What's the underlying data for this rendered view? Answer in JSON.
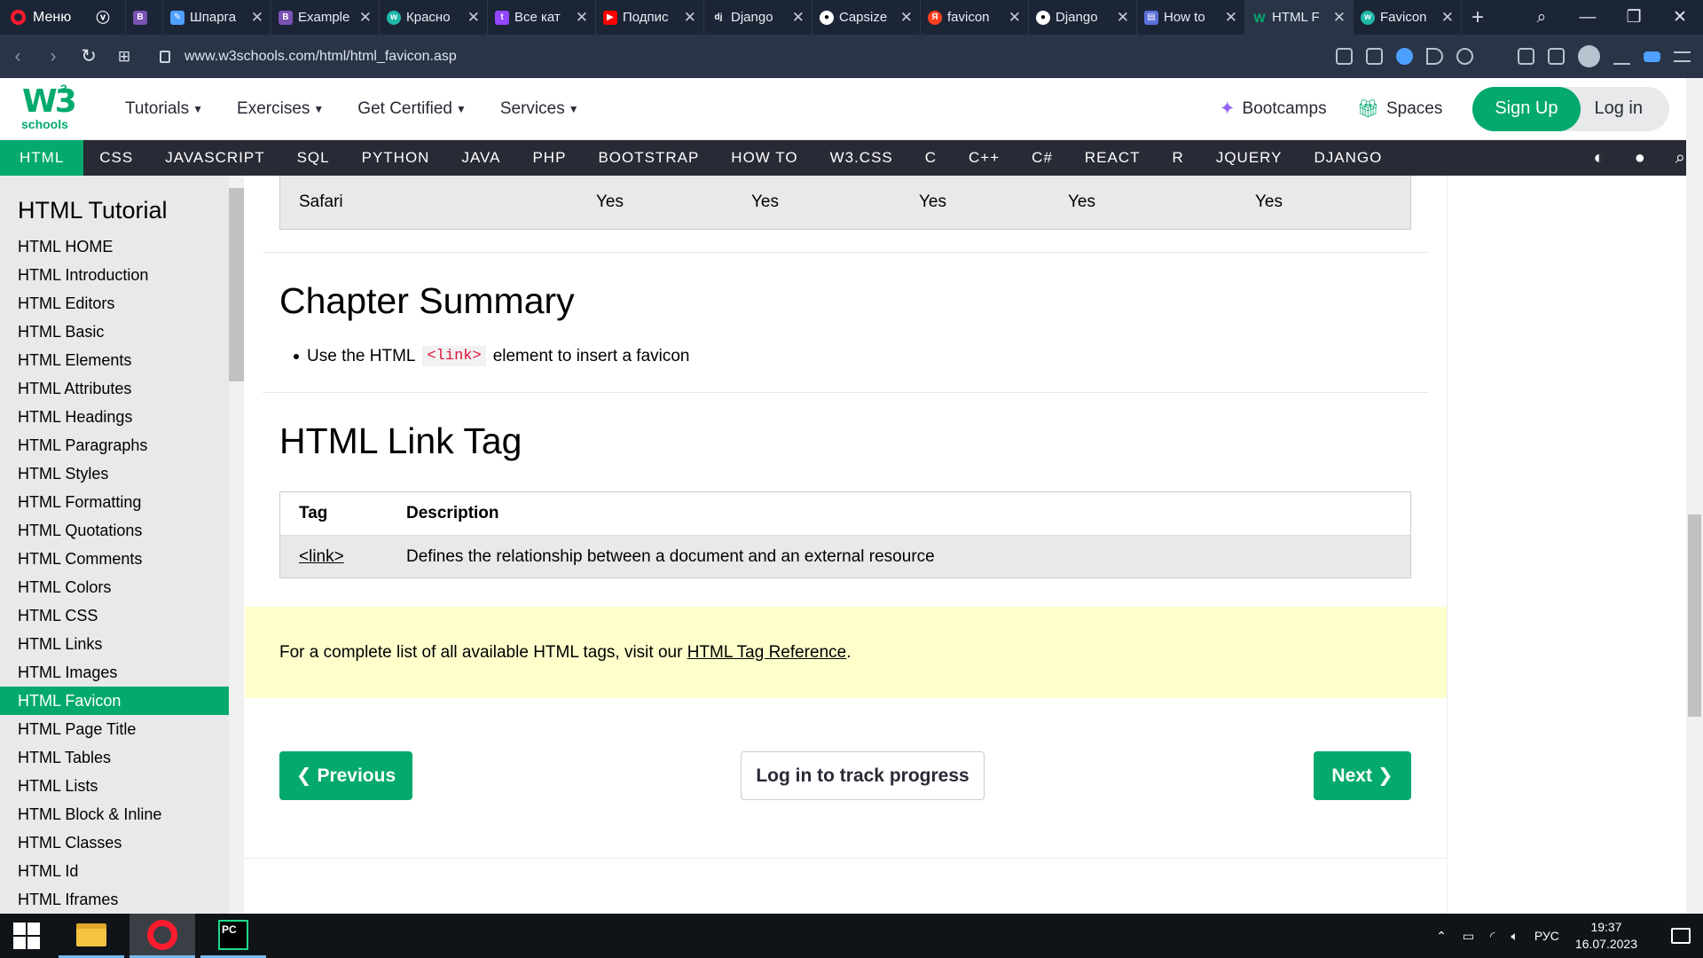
{
  "browser": {
    "menu_label": "Меню",
    "tabs": [
      {
        "label": "",
        "icon": "vk-icon",
        "color": "#0077ff"
      },
      {
        "label": "",
        "icon": "bootstrap-icon",
        "color": "#7952b3"
      },
      {
        "label": "Шпарга",
        "icon": "pen-icon",
        "color": "#4da0ff"
      },
      {
        "label": "Example",
        "icon": "bootstrap-icon",
        "color": "#7952b3"
      },
      {
        "label": "Красно",
        "icon": "w3-icon",
        "color": "#04aa6d"
      },
      {
        "label": "Все кат",
        "icon": "twitch-icon",
        "color": "#9146ff"
      },
      {
        "label": "Подпис",
        "icon": "youtube-icon",
        "color": "#ff0000"
      },
      {
        "label": "Django",
        "icon": "django-icon",
        "color": "#0c4b33"
      },
      {
        "label": "Capsize",
        "icon": "github-icon",
        "color": "#24292e"
      },
      {
        "label": "favicon",
        "icon": "yandex-icon",
        "color": "#fc3f1d"
      },
      {
        "label": "Django",
        "icon": "github-icon",
        "color": "#24292e"
      },
      {
        "label": "How to",
        "icon": "page-icon",
        "color": "#5b6fd9"
      },
      {
        "label": "HTML F",
        "icon": "w3-icon",
        "color": "#04aa6d",
        "active": true
      },
      {
        "label": "Favicon",
        "icon": "w3-icon",
        "color": "#04aa6d"
      }
    ],
    "url": "www.w3schools.com/html/html_favicon.asp"
  },
  "site": {
    "logo_text": "W3",
    "logo_sup": "3",
    "logo_sub": "schools",
    "menu": [
      "Tutorials",
      "Exercises",
      "Get Certified",
      "Services"
    ],
    "bootcamps": "Bootcamps",
    "spaces": "Spaces",
    "signup": "Sign Up",
    "login": "Log in",
    "brand_color": "#04aa6d"
  },
  "subjects": [
    "HTML",
    "CSS",
    "JAVASCRIPT",
    "SQL",
    "PYTHON",
    "JAVA",
    "PHP",
    "BOOTSTRAP",
    "HOW TO",
    "W3.CSS",
    "C",
    "C++",
    "C#",
    "REACT",
    "R",
    "JQUERY",
    "DJANGO"
  ],
  "sidebar": {
    "title": "HTML Tutorial",
    "items": [
      "HTML HOME",
      "HTML Introduction",
      "HTML Editors",
      "HTML Basic",
      "HTML Elements",
      "HTML Attributes",
      "HTML Headings",
      "HTML Paragraphs",
      "HTML Styles",
      "HTML Formatting",
      "HTML Quotations",
      "HTML Comments",
      "HTML Colors",
      "HTML CSS",
      "HTML Links",
      "HTML Images",
      "HTML Favicon",
      "HTML Page Title",
      "HTML Tables",
      "HTML Lists",
      "HTML Block & Inline",
      "HTML Classes",
      "HTML Id",
      "HTML Iframes"
    ],
    "active": "HTML Favicon"
  },
  "content": {
    "support_row": {
      "browser": "Safari",
      "values": [
        "Yes",
        "Yes",
        "Yes",
        "Yes",
        "Yes"
      ]
    },
    "summary_heading": "Chapter Summary",
    "summary_pre": "Use the HTML",
    "summary_code": "<link>",
    "summary_post": "element to insert a favicon",
    "link_heading": "HTML Link Tag",
    "table": {
      "headers": [
        "Tag",
        "Description"
      ],
      "rows": [
        [
          "<link>",
          "Defines the relationship between a document and an external resource"
        ]
      ]
    },
    "note_pre": "For a complete list of all available HTML tags, visit our",
    "note_link": "HTML Tag Reference",
    "note_post": ".",
    "prev": "Previous",
    "track": "Log in to track progress",
    "next": "Next"
  },
  "taskbar": {
    "lang": "РУС",
    "time": "19:37",
    "date": "16.07.2023"
  }
}
